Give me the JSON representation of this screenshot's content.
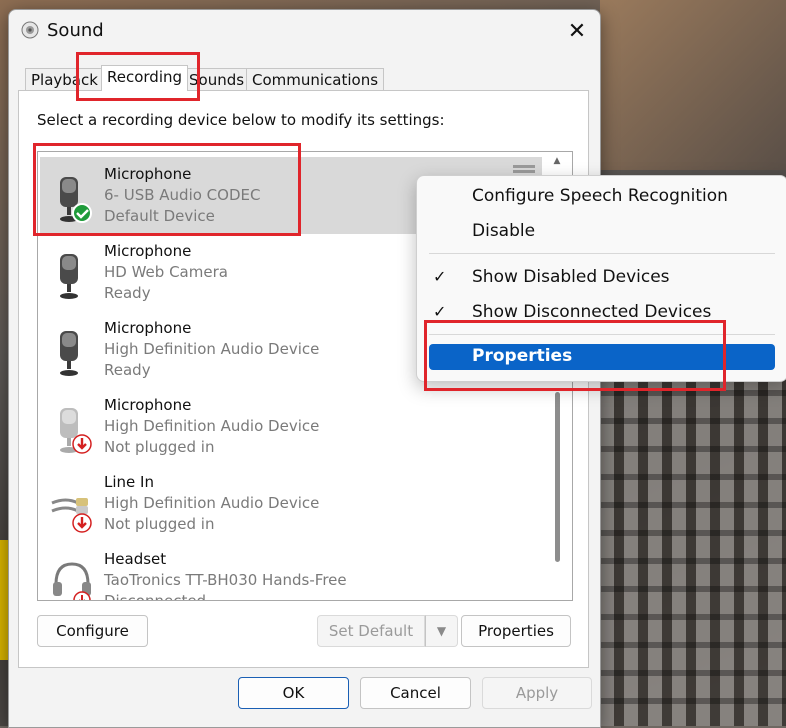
{
  "window": {
    "title": "Sound"
  },
  "tabs": [
    "Playback",
    "Recording",
    "Sounds",
    "Communications"
  ],
  "instructions": "Select a recording device below to modify its settings:",
  "devices": [
    {
      "name": "Microphone",
      "line2": "6- USB Audio CODEC",
      "line3": "Default Device",
      "status_icon": "check-badge-icon"
    },
    {
      "name": "Microphone",
      "line2": "HD Web Camera",
      "line3": "Ready",
      "status_icon": ""
    },
    {
      "name": "Microphone",
      "line2": "High Definition Audio Device",
      "line3": "Ready",
      "status_icon": ""
    },
    {
      "name": "Microphone",
      "line2": "High Definition Audio Device",
      "line3": "Not plugged in",
      "status_icon": "unplugged-badge-icon"
    },
    {
      "name": "Line In",
      "line2": "High Definition Audio Device",
      "line3": "Not plugged in",
      "status_icon": "unplugged-badge-icon"
    },
    {
      "name": "Headset",
      "line2": "TaoTronics TT-BH030 Hands-Free",
      "line3": "Disconnected",
      "status_icon": "unplugged-badge-icon"
    }
  ],
  "buttons": {
    "configure": "Configure",
    "set_default": "Set Default",
    "properties": "Properties",
    "ok": "OK",
    "cancel": "Cancel",
    "apply": "Apply"
  },
  "context_menu": {
    "items": [
      {
        "label": "Configure Speech Recognition",
        "checked": false
      },
      {
        "label": "Disable",
        "checked": false
      },
      {
        "label": "Show Disabled Devices",
        "checked": true
      },
      {
        "label": "Show Disconnected Devices",
        "checked": true
      },
      {
        "label": "Properties",
        "checked": false,
        "highlighted": true
      }
    ],
    "check_glyph": "✓"
  },
  "colors": {
    "highlight_box": "#e0252b",
    "menu_highlight": "#0a64c8",
    "check_badge": "#1f9b3a",
    "unplugged_badge": "#d42020"
  }
}
